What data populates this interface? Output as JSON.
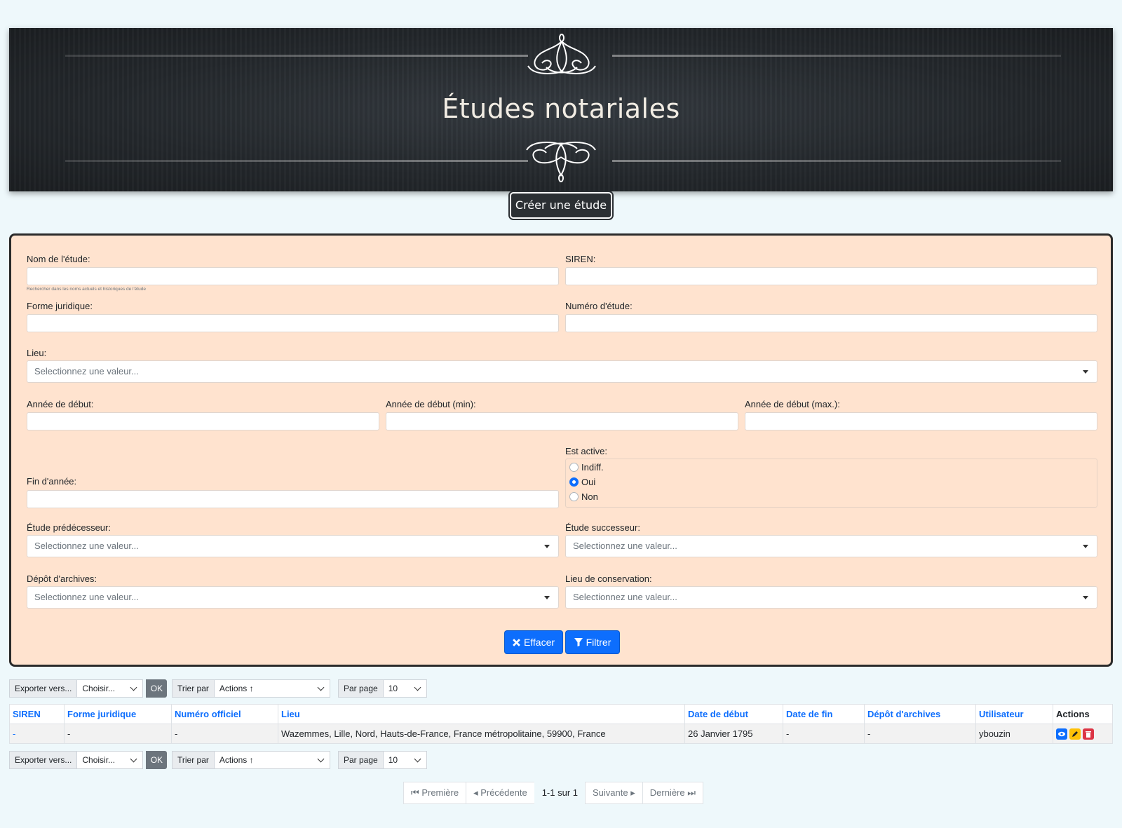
{
  "banner": {
    "title": "Études notariales"
  },
  "create_button": "Créer une étude",
  "filters": {
    "nom_label": "Nom de l'étude:",
    "nom_hint": "Rechercher dans les noms actuels et historiques de l'étude",
    "siren_label": "SIREN:",
    "forme_label": "Forme juridique:",
    "numero_label": "Numéro d'étude:",
    "lieu_label": "Lieu:",
    "lieu_placeholder": "Selectionnez une valeur...",
    "annee_debut_label": "Année de début:",
    "annee_min_label": "Année de début (min):",
    "annee_max_label": "Année de début (max.):",
    "est_active_label": "Est active:",
    "radio_options": [
      "Indiff.",
      "Oui",
      "Non"
    ],
    "radio_selected": "Oui",
    "fin_annee_label": "Fin d'année:",
    "predecesseur_label": "Étude prédécesseur:",
    "predecesseur_placeholder": "Selectionnez une valeur...",
    "successeur_label": "Étude successeur:",
    "successeur_placeholder": "Selectionnez une valeur...",
    "depot_label": "Dépôt d'archives:",
    "depot_placeholder": "Selectionnez une valeur...",
    "conservation_label": "Lieu de conservation:",
    "conservation_placeholder": "Selectionnez une valeur...",
    "effacer": "Effacer",
    "filtrer": "Filtrer"
  },
  "toolbar": {
    "export_label": "Exporter vers...",
    "export_value": "Choisir...",
    "ok": "OK",
    "sort_label": "Trier par",
    "sort_value": "Actions ↑",
    "perpage_label": "Par page",
    "perpage_value": "10"
  },
  "table": {
    "headers": [
      "SIREN",
      "Forme juridique",
      "Numéro officiel",
      "Lieu",
      "Date de début",
      "Date de fin",
      "Dépôt d'archives",
      "Utilisateur",
      "Actions"
    ],
    "rows": [
      {
        "siren": "-",
        "forme": "-",
        "numero": "-",
        "lieu": "Wazemmes, Lille, Nord, Hauts-de-France, France métropolitaine, 59900, France",
        "date_debut": "26 Janvier 1795",
        "date_fin": "-",
        "depot": "-",
        "utilisateur": "ybouzin"
      }
    ]
  },
  "pagination": {
    "first": "Première",
    "prev": "Précédente",
    "info": "1-1 sur 1",
    "next": "Suivante",
    "last": "Dernière"
  },
  "colors": {
    "accent": "#0d6efd",
    "panel": "#ffe3cf",
    "banner": "#23272b"
  }
}
